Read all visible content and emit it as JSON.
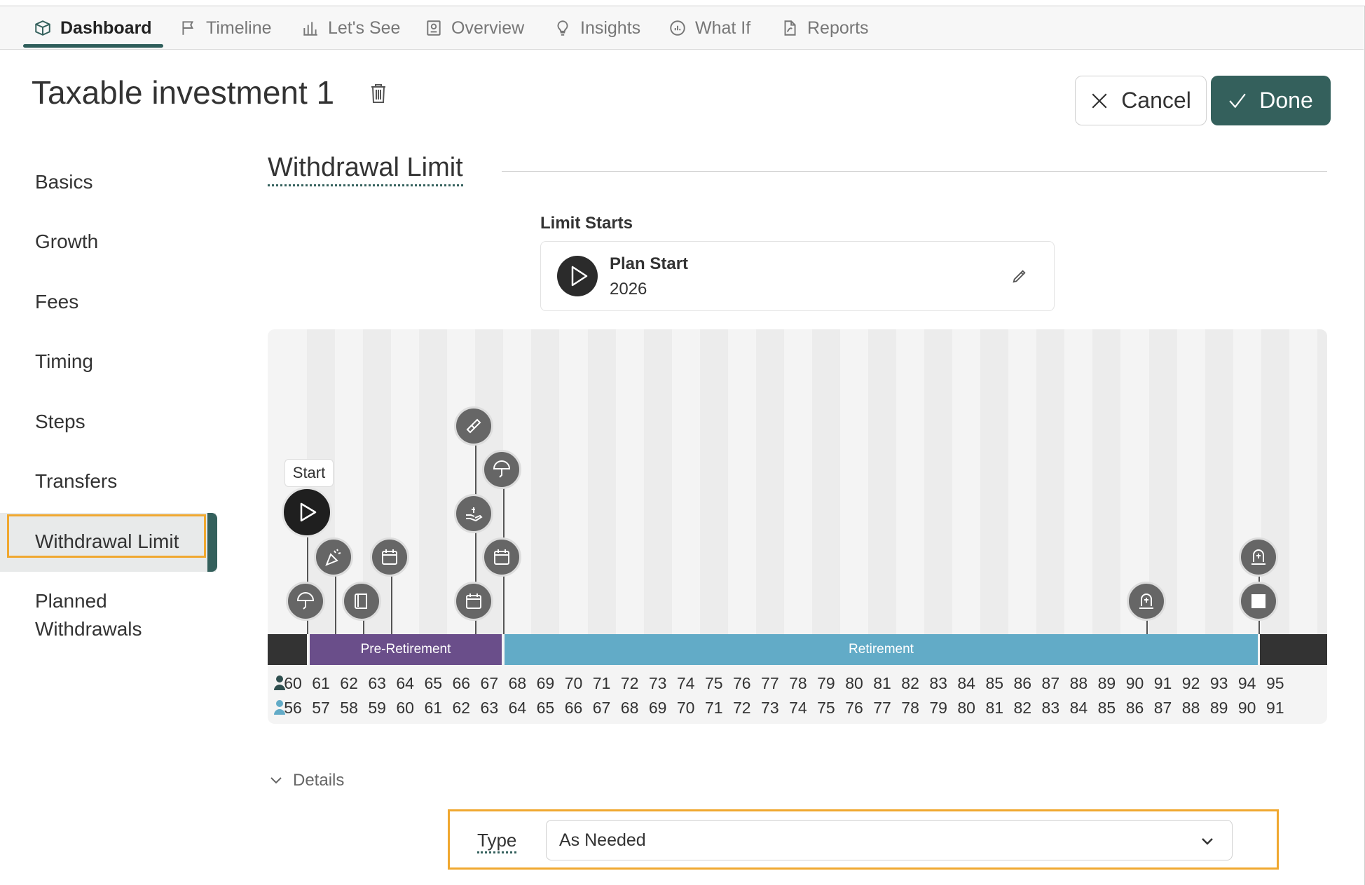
{
  "nav": {
    "tabs": [
      {
        "label": "Dashboard",
        "icon": "box-icon",
        "active": true
      },
      {
        "label": "Timeline",
        "icon": "flag-icon"
      },
      {
        "label": "Let's See",
        "icon": "bar-chart-icon"
      },
      {
        "label": "Overview",
        "icon": "report-icon"
      },
      {
        "label": "Insights",
        "icon": "lightbulb-icon"
      },
      {
        "label": "What If",
        "icon": "gauge-icon"
      },
      {
        "label": "Reports",
        "icon": "pdf-icon"
      }
    ]
  },
  "header": {
    "title": "Taxable investment 1",
    "cancel_label": "Cancel",
    "done_label": "Done"
  },
  "sidebar": {
    "items": [
      {
        "label": "Basics"
      },
      {
        "label": "Growth"
      },
      {
        "label": "Fees"
      },
      {
        "label": "Timing"
      },
      {
        "label": "Steps"
      },
      {
        "label": "Transfers"
      },
      {
        "label": "Withdrawal Limit",
        "active": true
      },
      {
        "label": "Planned"
      },
      {
        "label": "Withdrawals"
      }
    ]
  },
  "section": {
    "title": "Withdrawal Limit",
    "limit_starts_label": "Limit Starts",
    "limit_card": {
      "name": "Plan Start",
      "year": "2026"
    }
  },
  "timeline": {
    "start_tag": "Start",
    "phases": [
      {
        "label": "",
        "color": "#333333"
      },
      {
        "label": "Pre-Retirement",
        "color": "#6a4e8a"
      },
      {
        "label": "Retirement",
        "color": "#62abc7"
      },
      {
        "label": "",
        "color": "#333333"
      }
    ],
    "ages_person1": [
      "60",
      "61",
      "62",
      "63",
      "64",
      "65",
      "66",
      "67",
      "68",
      "69",
      "70",
      "71",
      "72",
      "73",
      "74",
      "75",
      "76",
      "77",
      "78",
      "79",
      "80",
      "81",
      "82",
      "83",
      "84",
      "85",
      "86",
      "87",
      "88",
      "89",
      "90",
      "91",
      "92",
      "93",
      "94",
      "95"
    ],
    "ages_person2": [
      "56",
      "57",
      "58",
      "59",
      "60",
      "61",
      "62",
      "63",
      "64",
      "65",
      "66",
      "67",
      "68",
      "69",
      "70",
      "71",
      "72",
      "73",
      "74",
      "75",
      "76",
      "77",
      "78",
      "79",
      "80",
      "81",
      "82",
      "83",
      "84",
      "85",
      "86",
      "87",
      "88",
      "89",
      "90",
      "91"
    ],
    "person1_color": "#2f4f4f",
    "person2_color": "#62abc7"
  },
  "details": {
    "toggle_label": "Details",
    "type_label": "Type",
    "type_value": "As Needed"
  }
}
